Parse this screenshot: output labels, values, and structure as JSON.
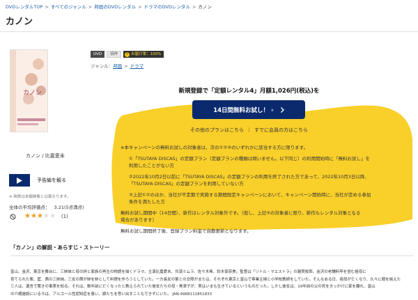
{
  "breadcrumb": [
    "DVDレンタルTOP",
    "すべてのジャンル",
    "邦画のDVDレンタル",
    "ドラマのDVDレンタル",
    "カノン"
  ],
  "title": "カノン",
  "cover": {
    "alt": "カノン"
  },
  "badges": {
    "dvd": "DVD",
    "old": "旧作",
    "coin": "P",
    "pct_label": "お届け率：100%"
  },
  "genre": {
    "label": "ジャンル：",
    "items": [
      "邦画",
      "ドラマ"
    ]
  },
  "cast": "カノン / 比嘉愛未",
  "preview": {
    "label": "予告編を観る"
  },
  "note": "※ 画質は本編映像とは異なります。",
  "rating": {
    "label": "全体の平均評価点：",
    "score": "3.21(5点満点)",
    "value": 3.21,
    "max": 5,
    "review_count": "(1)"
  },
  "campaign": {
    "headline": "新規登録で「定額レンタル4」月額1,026円(税込)を",
    "cta_main": "14日間無料お試し！",
    "cta_small": "※",
    "other_plan": "その他のプランはこちら",
    "member": "すでに会員の方はこちら",
    "pipe": "｜",
    "accent": "#f9cf2a",
    "button_color": "#0b2a6e"
  },
  "terms": {
    "intro": "※本キャンペーンの無料お試しの対象者は、次の①②③のいずれかに該当する方に限ります。",
    "c1_a": "①「TSUTAYA DISCAS」の定額プラン（定額プランの種類は問いません。以下同じ）の利用開始時に「無料お試し」を",
    "c1_b": "利用したことがない方",
    "c2_a": "②2022年10月2日以前に「TSUTAYA DISCAS」の定額プランの利用を終了された方であって、2022年10月3日以降、",
    "c2_b": "「TSUTAYA DISCAS」の定額プランを利用していない方",
    "c3_a": "③上記①②のほか、当社が不定期で実施する期間限定キャンペーンにおいて、キャンペーン開始時に、当社が定める参加",
    "c3_b": "条件を満たした方",
    "p1_a": "無料お試し期間中（14日間）、新作はレンタル対象外です。（但し、上記③の対象者に限り、新作もレンタル対象となる",
    "p1_b": "場合があります）",
    "p2": "無料お試し期間終了後、登録プラン料金で自動更新となります。"
  },
  "story": {
    "heading": "「カノン」の解説・あらすじ・ストーリー",
    "line1": "富山、金沢、東京を舞台に、三姉妹と母の絆と家族の再生の物語を描くドラマ。主演比嘉愛未、共演ミムラ、佐々木希、鈴木保奈美。監督は「リトル・マエストラ」の雑賀俊郎。金沢の老舗料亭を営む祖母に",
    "line2": "育てられた紫、藍、茜の三姉妹。三女の茜が姉を姉として料理を作ろうとしていた。一方長女の紫との交際がまたは、それぞれ東京と富山で専業主婦と小学校教師をしていた。そんなある日、祖母が亡くなり、久々に顔を揃えた",
    "line3": "三人は、遺言で驚きの事実を知る。それは、数年前に亡くなったと教えられていた彼女たちの母・美津子が、実はいまも生きているというものだった。しかし彼女は、19年前の父の死をきっかけに家を離れ、富山",
    "line4": "の介護施設にいる今は、アルコール性認知症を患い、娘たちを思い出すこともできずにいた。 JAN:4988111851833"
  }
}
